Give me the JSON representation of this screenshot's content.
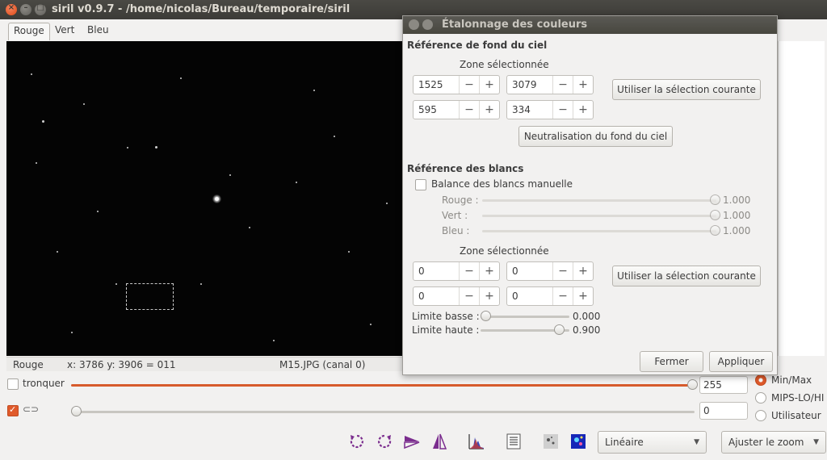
{
  "window": {
    "title": "siril v0.9.7 - /home/nicolas/Bureau/temporaire/siril"
  },
  "channel_tabs": [
    "Rouge",
    "Vert",
    "Bleu"
  ],
  "status_bar": {
    "channel": "Rouge",
    "coords": "x: 3786 y: 3906 = 011",
    "file": "M15.JPG (canal 0)"
  },
  "sliders": {
    "clip_label": "tronquer",
    "high_value": "255",
    "low_value": "0",
    "high_level": 1.0,
    "low_level": 0.0
  },
  "scale_mode": {
    "options": [
      "Min/Max",
      "MIPS-LO/HI",
      "Utilisateur"
    ],
    "selected": "Min/Max"
  },
  "toolbar": {
    "icons": [
      "rotate-left-icon",
      "rotate-right-icon",
      "mirror-horizontal-icon",
      "mirror-vertical-icon",
      "histogram-icon",
      "list-icon",
      "negative-icon",
      "false-color-icon"
    ],
    "display_mode": "Linéaire",
    "zoom": "Ajuster le zoom"
  },
  "dialog": {
    "title": "Étalonnage des couleurs",
    "sky": {
      "heading": "Référence de fond du ciel",
      "zone_label": "Zone sélectionnée",
      "x": "1525",
      "y": "3079",
      "w": "595",
      "h": "334",
      "use_selection": "Utiliser la sélection courante",
      "neutralize": "Neutralisation du fond du ciel"
    },
    "white": {
      "heading": "Référence des blancs",
      "manual_label": "Balance des blancs manuelle",
      "manual_checked": false,
      "red_label": "Rouge :",
      "red_value": "1.000",
      "green_label": "Vert :",
      "green_value": "1.000",
      "blue_label": "Bleu :",
      "blue_value": "1.000",
      "zone_label": "Zone sélectionnée",
      "x": "0",
      "y": "0",
      "w": "0",
      "h": "0",
      "use_selection": "Utiliser la sélection courante",
      "low_label": "Limite basse :",
      "low_value": "0.000",
      "high_label": "Limite haute :",
      "high_value": "0.900"
    },
    "close_label": "Fermer",
    "apply_label": "Appliquer"
  },
  "colors": {
    "accent": "#e05a2b",
    "icon_purple": "#7b2d8e"
  }
}
